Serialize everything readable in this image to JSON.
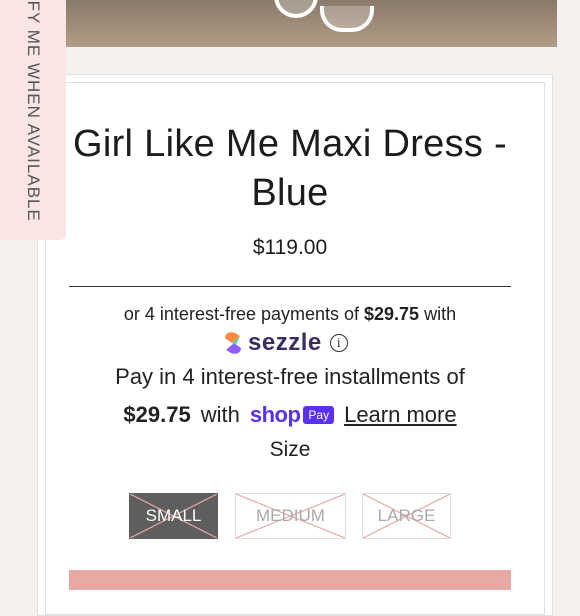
{
  "notify_tab": {
    "label": "NOTIFY ME WHEN AVAILABLE"
  },
  "product": {
    "title": "Girl Like Me Maxi Dress - Blue",
    "price": "$119.00"
  },
  "sezzle": {
    "text_before": "or 4 interest-free payments of ",
    "amount": "$29.75",
    "text_after": " with",
    "brand": "sezzle",
    "info": "i"
  },
  "shop_pay": {
    "line1": "Pay in 4 interest-free installments of",
    "amount": "$29.75",
    "with": "with",
    "shop": "shop",
    "pay": "Pay",
    "learn_more": "Learn more"
  },
  "size": {
    "label": "Size",
    "options": [
      {
        "label": "SMALL",
        "selected": true,
        "available": false
      },
      {
        "label": "MEDIUM",
        "selected": false,
        "available": false
      },
      {
        "label": "LARGE",
        "selected": false,
        "available": false
      }
    ]
  },
  "colors": {
    "tab_bg": "#f9e6e4",
    "cart_button": "#e8a9a4",
    "shop_pay": "#5a31f4",
    "sezzle_text": "#3b2d63",
    "strike": "#e8a9a4"
  }
}
